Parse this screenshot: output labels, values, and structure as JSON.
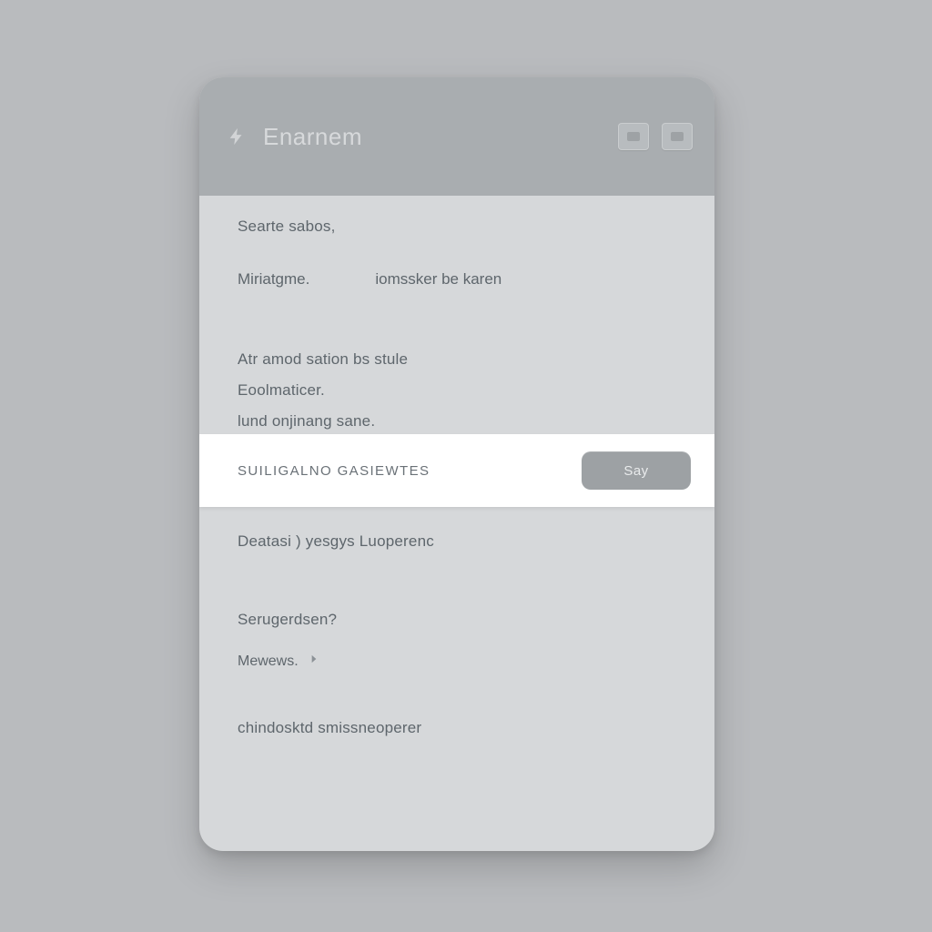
{
  "header": {
    "title": "Enarnem",
    "leading_icon": "bolt-icon",
    "action1_icon": "picture-icon",
    "action2_icon": "card-icon"
  },
  "section1": {
    "searte": "Searte sabos,",
    "kv": {
      "k": "Miriatgme.",
      "v": "iomssker be karen"
    }
  },
  "section2": {
    "line1": "Atr amod sation bs stule",
    "line2": "Eoolmaticer.",
    "line3": "lund onjinang sane."
  },
  "highlight": {
    "label": "SUILIGALNO GASIEWTES",
    "button": "Say"
  },
  "lower": {
    "deatasi": "Deatasi ) yesgys Luoperenc",
    "sergerdsen": "Serugerdsen?",
    "menews": "Mewews.",
    "chirdoske": "chindosktd smissneoperer"
  }
}
